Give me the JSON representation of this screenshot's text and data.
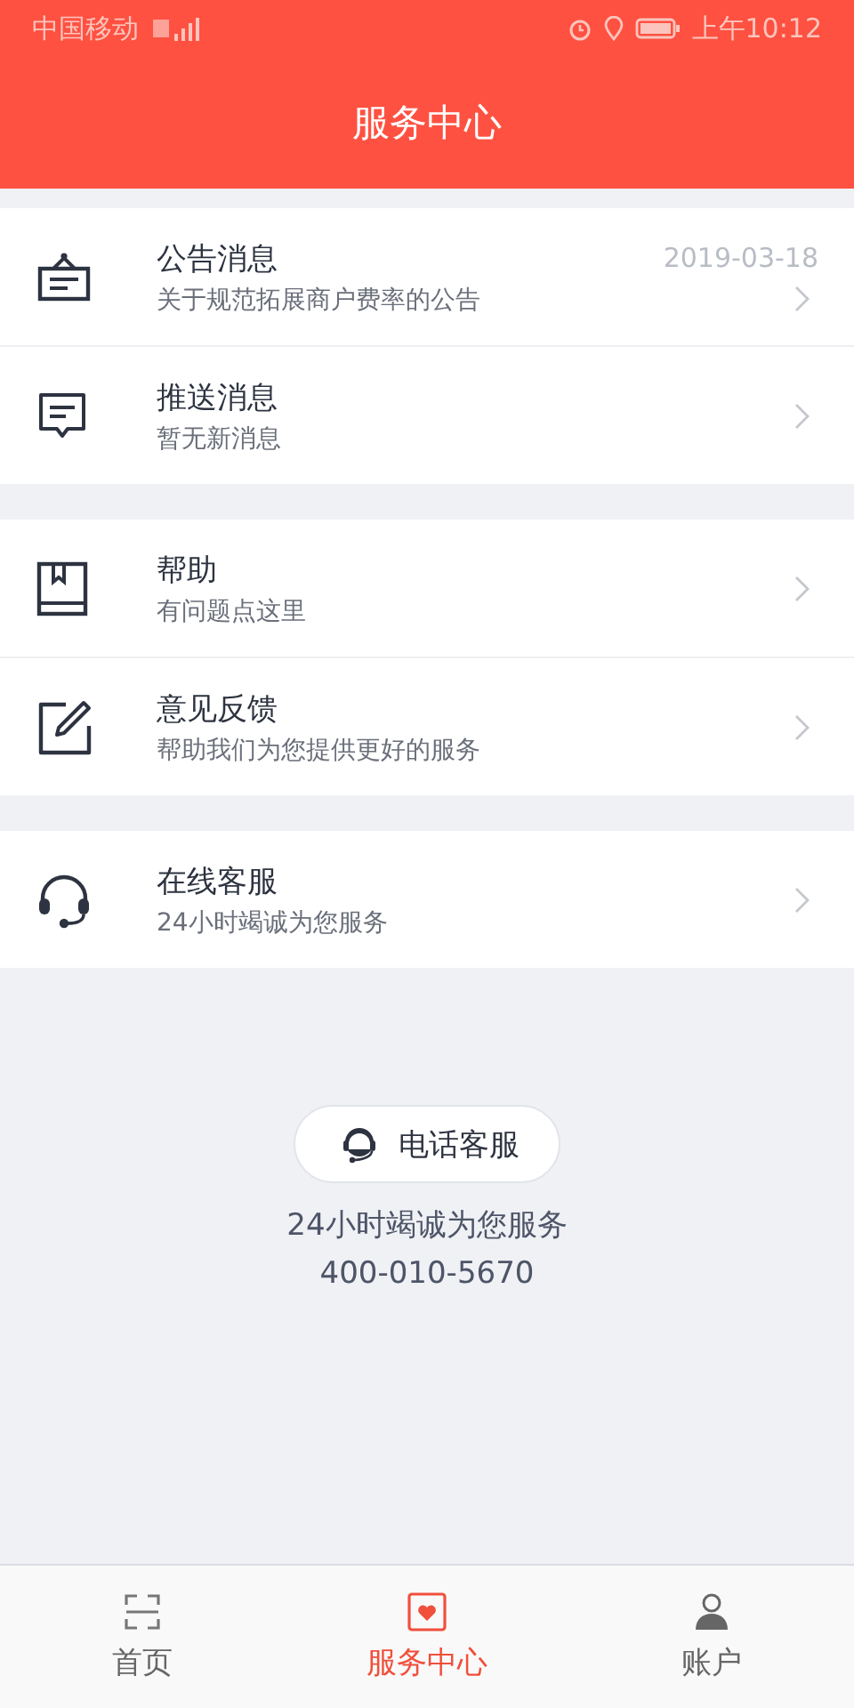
{
  "status_bar": {
    "carrier": "中国移动",
    "time": "上午10:12"
  },
  "header": {
    "title": "服务中心"
  },
  "groups": [
    {
      "items": [
        {
          "kind": "notice",
          "title": "公告消息",
          "subtitle": "关于规范拓展商户费率的公告",
          "date": "2019-03-18"
        },
        {
          "kind": "message",
          "title": "推送消息",
          "subtitle": "暂无新消息"
        }
      ]
    },
    {
      "items": [
        {
          "kind": "help",
          "title": "帮助",
          "subtitle": "有问题点这里"
        },
        {
          "kind": "feedback",
          "title": "意见反馈",
          "subtitle": "帮助我们为您提供更好的服务"
        }
      ]
    },
    {
      "items": [
        {
          "kind": "headset",
          "title": "在线客服",
          "subtitle": "24小时竭诚为您服务"
        }
      ]
    }
  ],
  "phone_service": {
    "button": "电话客服",
    "hours": "24小时竭诚为您服务",
    "number": "400-010-5670"
  },
  "tabs": [
    {
      "kind": "home",
      "label": "首页",
      "selected": false
    },
    {
      "kind": "service",
      "label": "服务中心",
      "selected": true
    },
    {
      "kind": "account",
      "label": "账户",
      "selected": false
    }
  ]
}
